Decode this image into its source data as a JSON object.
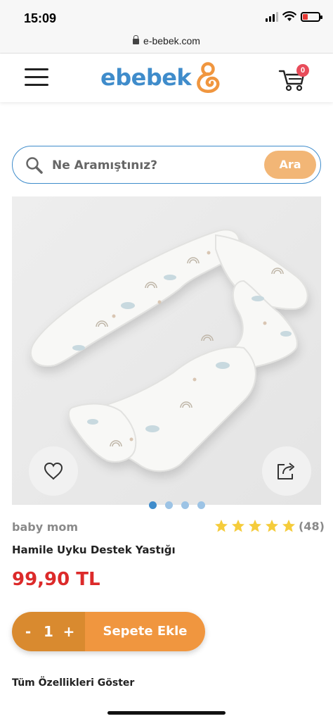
{
  "status_bar": {
    "time": "15:09"
  },
  "browser": {
    "url": "e-bebek.com"
  },
  "header": {
    "logo_text": "ebebek",
    "cart_count": "0",
    "brand_color": "#3f8ccb",
    "logo_accent_color": "#f0963f"
  },
  "search": {
    "placeholder": "Ne Aramıştınız?",
    "value": "",
    "button_label": "Ara"
  },
  "gallery": {
    "dots": 4,
    "active_index": 0
  },
  "product": {
    "brand": "baby mom",
    "rating": 5,
    "review_count": "(48)",
    "title": "Hamile Uyku Destek Yastığı",
    "price": "99,90 TL",
    "price_color": "#dc2a2a"
  },
  "cart_action": {
    "minus": "-",
    "quantity": "1",
    "plus": "+",
    "add_label": "Sepete Ekle"
  },
  "links": {
    "all_features": "Tüm Özellikleri Göster"
  },
  "icons": [
    "menu-icon",
    "cart-icon",
    "search-icon",
    "heart-icon",
    "share-icon",
    "star-icon",
    "lock-icon"
  ]
}
